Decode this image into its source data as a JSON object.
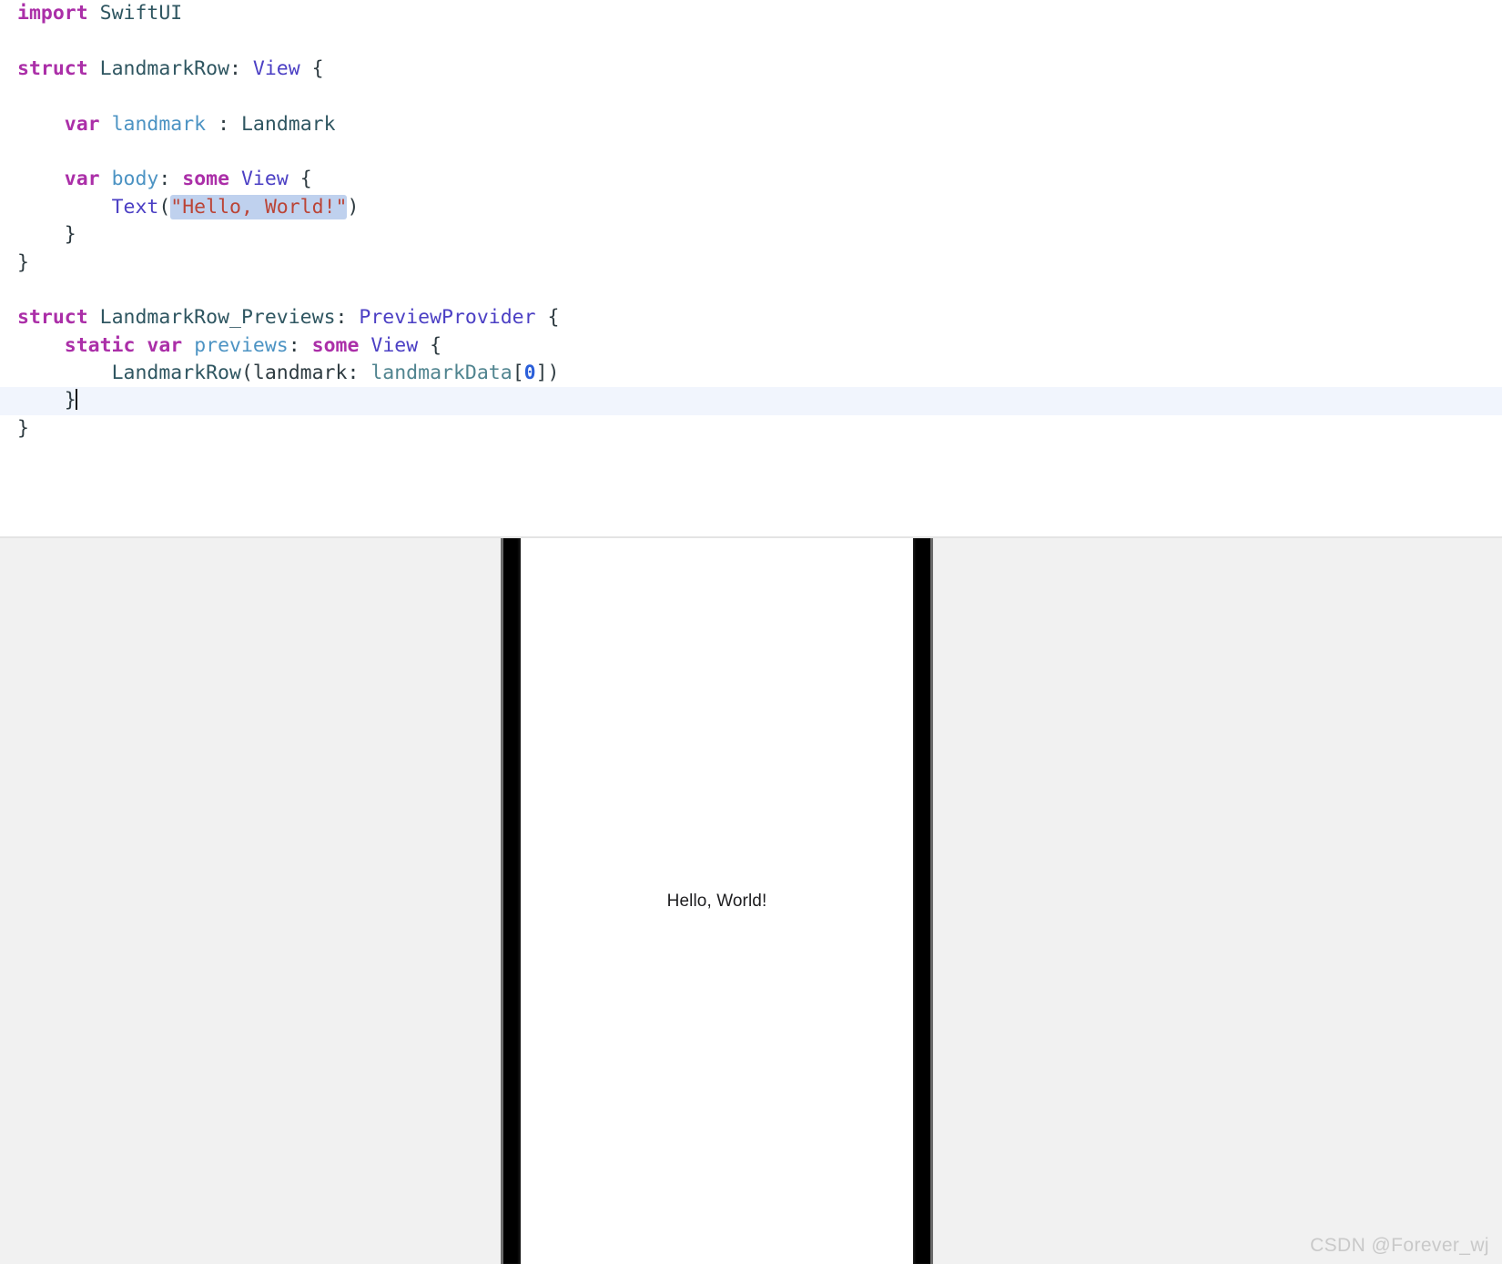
{
  "editor": {
    "language": "Swift",
    "background_color": "#ffffff",
    "current_line_highlight_color": "#f1f5fd",
    "selection_color": "#bfd1ee",
    "lines": [
      {
        "n": 1,
        "tokens": [
          {
            "t": "import",
            "c": "kw"
          },
          {
            "t": " ",
            "c": "plain"
          },
          {
            "t": "SwiftUI",
            "c": "type"
          }
        ]
      },
      {
        "n": 2,
        "tokens": []
      },
      {
        "n": 3,
        "tokens": [
          {
            "t": "struct",
            "c": "kw"
          },
          {
            "t": " ",
            "c": "plain"
          },
          {
            "t": "LandmarkRow",
            "c": "type"
          },
          {
            "t": ": ",
            "c": "punct"
          },
          {
            "t": "View",
            "c": "proto"
          },
          {
            "t": " {",
            "c": "punct"
          }
        ]
      },
      {
        "n": 4,
        "tokens": []
      },
      {
        "n": 5,
        "tokens": [
          {
            "t": "    ",
            "c": "plain"
          },
          {
            "t": "var",
            "c": "kw"
          },
          {
            "t": " ",
            "c": "plain"
          },
          {
            "t": "landmark",
            "c": "varname"
          },
          {
            "t": " : ",
            "c": "punct"
          },
          {
            "t": "Landmark",
            "c": "type"
          }
        ]
      },
      {
        "n": 6,
        "tokens": []
      },
      {
        "n": 7,
        "tokens": [
          {
            "t": "    ",
            "c": "plain"
          },
          {
            "t": "var",
            "c": "kw"
          },
          {
            "t": " ",
            "c": "plain"
          },
          {
            "t": "body",
            "c": "prop"
          },
          {
            "t": ": ",
            "c": "punct"
          },
          {
            "t": "some",
            "c": "kw2"
          },
          {
            "t": " ",
            "c": "plain"
          },
          {
            "t": "View",
            "c": "proto"
          },
          {
            "t": " {",
            "c": "punct"
          }
        ]
      },
      {
        "n": 8,
        "tokens": [
          {
            "t": "        ",
            "c": "plain"
          },
          {
            "t": "Text",
            "c": "fn"
          },
          {
            "t": "(",
            "c": "punct"
          },
          {
            "t": "\"Hello, World!\"",
            "c": "str",
            "sel": true
          },
          {
            "t": ")",
            "c": "punct"
          }
        ]
      },
      {
        "n": 9,
        "tokens": [
          {
            "t": "    }",
            "c": "punct"
          }
        ]
      },
      {
        "n": 10,
        "tokens": [
          {
            "t": "}",
            "c": "punct"
          }
        ]
      },
      {
        "n": 11,
        "tokens": []
      },
      {
        "n": 12,
        "tokens": [
          {
            "t": "struct",
            "c": "kw"
          },
          {
            "t": " ",
            "c": "plain"
          },
          {
            "t": "LandmarkRow_Previews",
            "c": "type"
          },
          {
            "t": ": ",
            "c": "punct"
          },
          {
            "t": "PreviewProvider",
            "c": "proto"
          },
          {
            "t": " {",
            "c": "punct"
          }
        ]
      },
      {
        "n": 13,
        "tokens": [
          {
            "t": "    ",
            "c": "plain"
          },
          {
            "t": "static var",
            "c": "kw"
          },
          {
            "t": " ",
            "c": "plain"
          },
          {
            "t": "previews",
            "c": "prop"
          },
          {
            "t": ": ",
            "c": "punct"
          },
          {
            "t": "some",
            "c": "kw2"
          },
          {
            "t": " ",
            "c": "plain"
          },
          {
            "t": "View",
            "c": "proto"
          },
          {
            "t": " {",
            "c": "punct"
          }
        ]
      },
      {
        "n": 14,
        "tokens": [
          {
            "t": "        ",
            "c": "plain"
          },
          {
            "t": "LandmarkRow",
            "c": "type"
          },
          {
            "t": "(landmark: ",
            "c": "punct"
          },
          {
            "t": "landmarkData",
            "c": "ident"
          },
          {
            "t": "[",
            "c": "punct"
          },
          {
            "t": "0",
            "c": "num"
          },
          {
            "t": "])",
            "c": "punct"
          }
        ]
      },
      {
        "n": 15,
        "current": true,
        "caret": true,
        "tokens": [
          {
            "t": "    }",
            "c": "punct"
          }
        ]
      },
      {
        "n": 16,
        "tokens": [
          {
            "t": "}",
            "c": "punct"
          }
        ]
      }
    ]
  },
  "preview": {
    "canvas_background_color": "#f1f1f1",
    "device_screen_background_color": "#ffffff",
    "bezel_color": "#000000",
    "content_text": "Hello, World!"
  },
  "watermark": {
    "text": "CSDN @Forever_wj",
    "color": "#c9c9c9"
  }
}
